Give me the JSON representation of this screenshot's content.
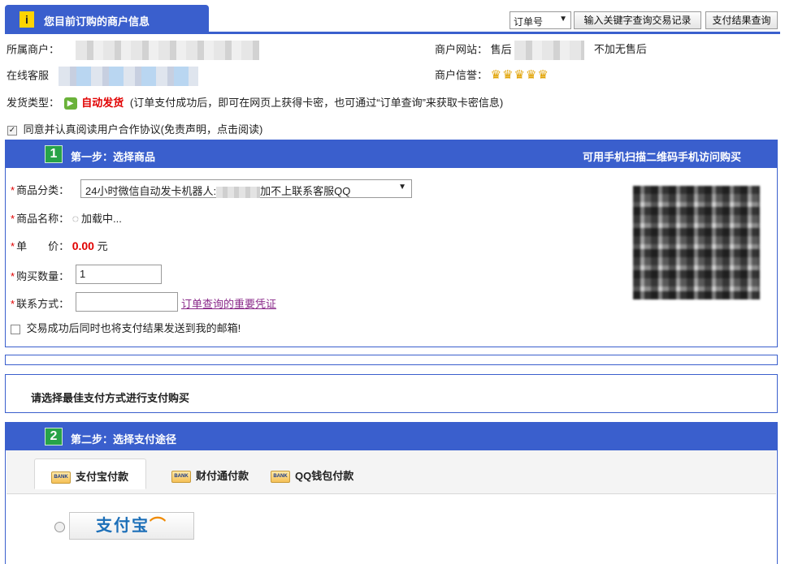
{
  "header": {
    "merchant_info_title": "您目前订购的商户信息",
    "info_badge": "i",
    "search_type": "订单号",
    "keyword_button": "输入关键字查询交易记录",
    "result_button": "支付结果查询"
  },
  "merchant": {
    "owner_label": "所属商户：",
    "website_label": "商户网站：",
    "website_prefix": "售后",
    "website_suffix": "不加无售后",
    "service_label": "在线客服",
    "credit_label": "商户信誉：",
    "credit_crowns": 5,
    "shipping_label": "发货类型：",
    "shipping_value": "自动发货",
    "shipping_note": "(订单支付成功后，即可在网页上获得卡密，也可通过“订单查询”来获取卡密信息)",
    "agreement": "同意并认真阅读用户合作协议(免责声明，点击阅读)",
    "agreement_checked": true
  },
  "step1": {
    "number": "1",
    "title": "第一步：选择商品",
    "qr_hint": "可用手机扫描二维码手机访问购买",
    "category_label": "商品分类：",
    "category_value_a": "24小时微信自动发卡机器人:",
    "category_value_b": "加不上联系客服QQ",
    "name_label": "商品名称：",
    "name_value": "加载中...",
    "price_label": "单　　价：",
    "price_value": "0.00",
    "price_unit": "元",
    "quantity_label": "购买数量：",
    "quantity_value": "1",
    "contact_label": "联系方式：",
    "contact_value": "",
    "contact_link": "订单查询的重要凭证",
    "email_option": "交易成功后同时也将支付结果发送到我的邮箱!",
    "email_checked": false
  },
  "choose_payment": "请选择最佳支付方式进行支付购买",
  "step2": {
    "number": "2",
    "title": "第二步：选择支付途径",
    "bank_icon_text": "BANK",
    "tabs": [
      "支付宝付款",
      "财付通付款",
      "QQ钱包付款"
    ],
    "active_tab": 0,
    "alipay_logo": "支付宝"
  },
  "colors": {
    "accent_blue": "#3a5fcd",
    "step_green": "#27a348",
    "alert_red": "#e10000",
    "badge_yellow": "#ffd400"
  }
}
